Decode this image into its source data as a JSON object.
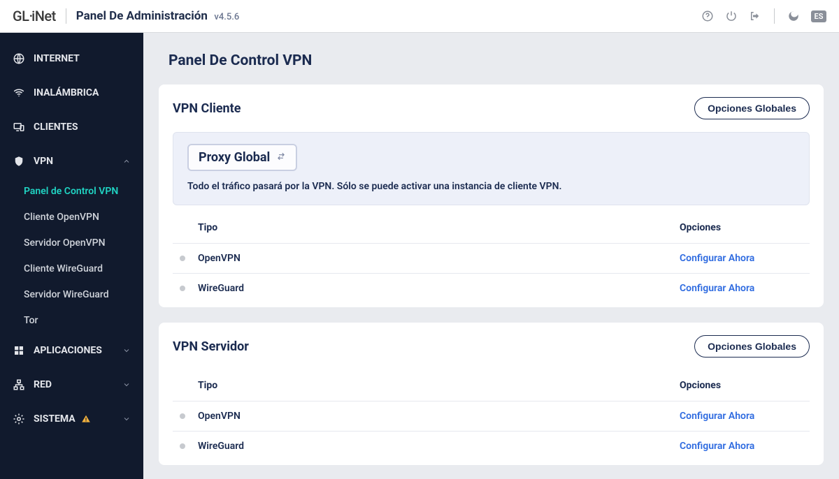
{
  "topbar": {
    "brand_prefix": "GL",
    "brand_suffix": "iNet",
    "title": "Panel De Administración",
    "version": "v4.5.6",
    "lang": "ES"
  },
  "sidebar": {
    "items": [
      {
        "id": "internet",
        "label": "INTERNET"
      },
      {
        "id": "wireless",
        "label": "INALÁMBRICA"
      },
      {
        "id": "clients",
        "label": "CLIENTES"
      },
      {
        "id": "vpn",
        "label": "VPN"
      },
      {
        "id": "apps",
        "label": "APLICACIONES"
      },
      {
        "id": "network",
        "label": "RED"
      },
      {
        "id": "system",
        "label": "SISTEMA"
      }
    ],
    "vpn_sub": [
      {
        "id": "vpn-dashboard",
        "label": "Panel de Control VPN",
        "active": true
      },
      {
        "id": "openvpn-client",
        "label": "Cliente OpenVPN"
      },
      {
        "id": "openvpn-server",
        "label": "Servidor OpenVPN"
      },
      {
        "id": "wg-client",
        "label": "Cliente WireGuard"
      },
      {
        "id": "wg-server",
        "label": "Servidor WireGuard"
      },
      {
        "id": "tor",
        "label": "Tor"
      }
    ]
  },
  "page": {
    "title": "Panel De Control VPN",
    "client_panel": {
      "title": "VPN Cliente",
      "options_button": "Opciones Globales",
      "proxy_label": "Proxy Global",
      "description": "Todo el tráfico pasará por la VPN. Sólo se puede activar una instancia de cliente VPN.",
      "header_type": "Tipo",
      "header_opt": "Opciones",
      "rows": [
        {
          "type": "OpenVPN",
          "link": "Configurar Ahora"
        },
        {
          "type": "WireGuard",
          "link": "Configurar Ahora"
        }
      ]
    },
    "server_panel": {
      "title": "VPN Servidor",
      "options_button": "Opciones Globales",
      "header_type": "Tipo",
      "header_opt": "Opciones",
      "rows": [
        {
          "type": "OpenVPN",
          "link": "Configurar Ahora"
        },
        {
          "type": "WireGuard",
          "link": "Configurar Ahora"
        }
      ]
    }
  }
}
